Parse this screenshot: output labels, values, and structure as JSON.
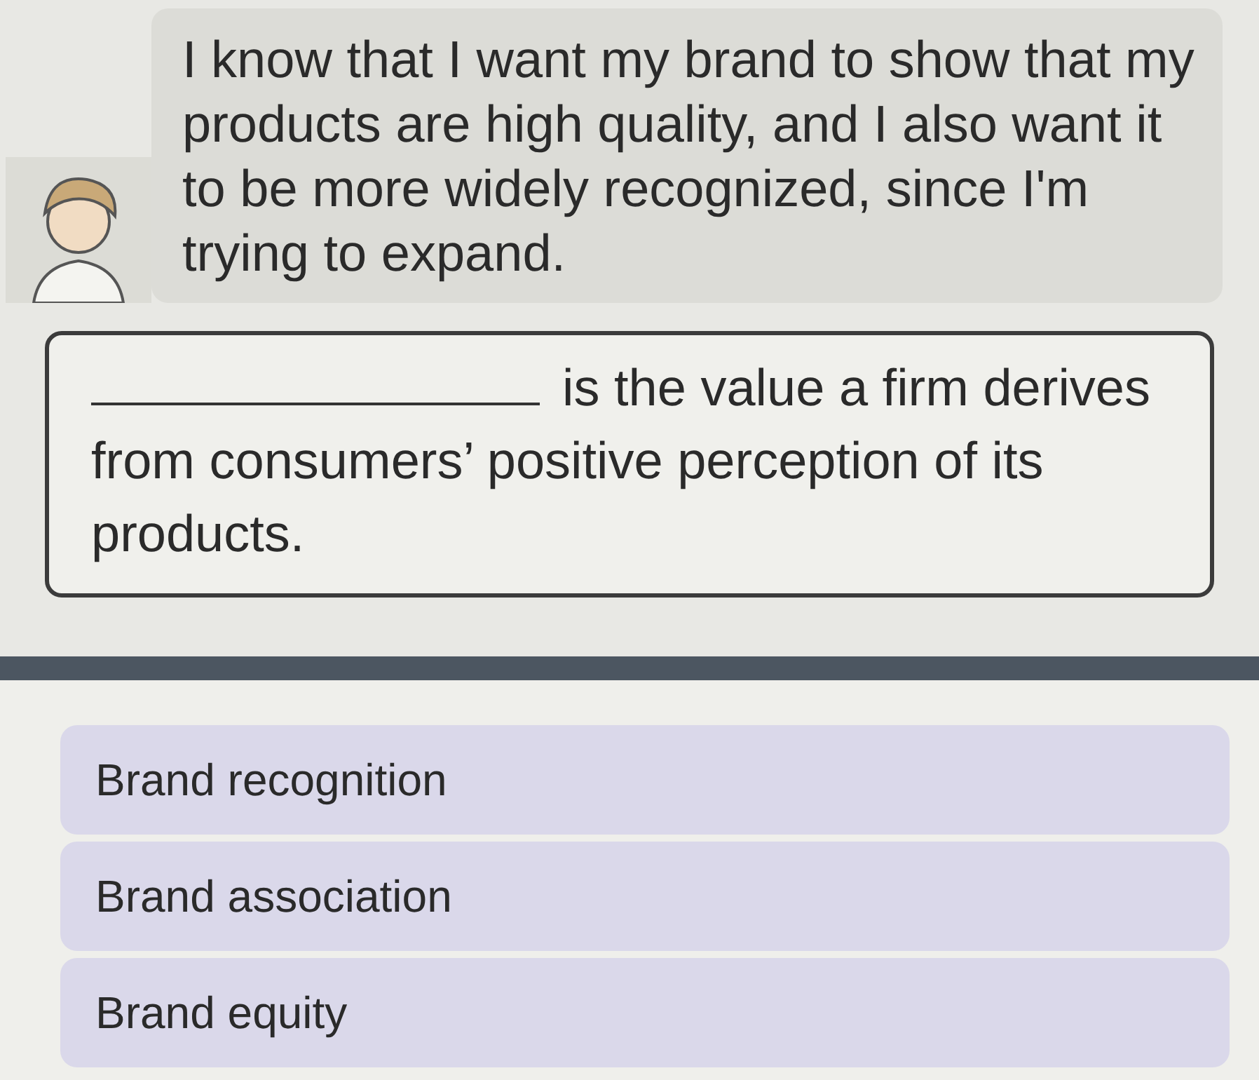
{
  "speech": {
    "text": "I know that I want my brand to show that my products are high quality, and I also want it to be more widely recognized, since I'm trying to expand."
  },
  "question": {
    "text": "is the value a firm derives from consumers’ positive perception of its products."
  },
  "options": [
    {
      "label": "Brand recognition",
      "selected": false
    },
    {
      "label": "Brand association",
      "selected": false
    },
    {
      "label": "Brand equity",
      "selected": false
    }
  ]
}
